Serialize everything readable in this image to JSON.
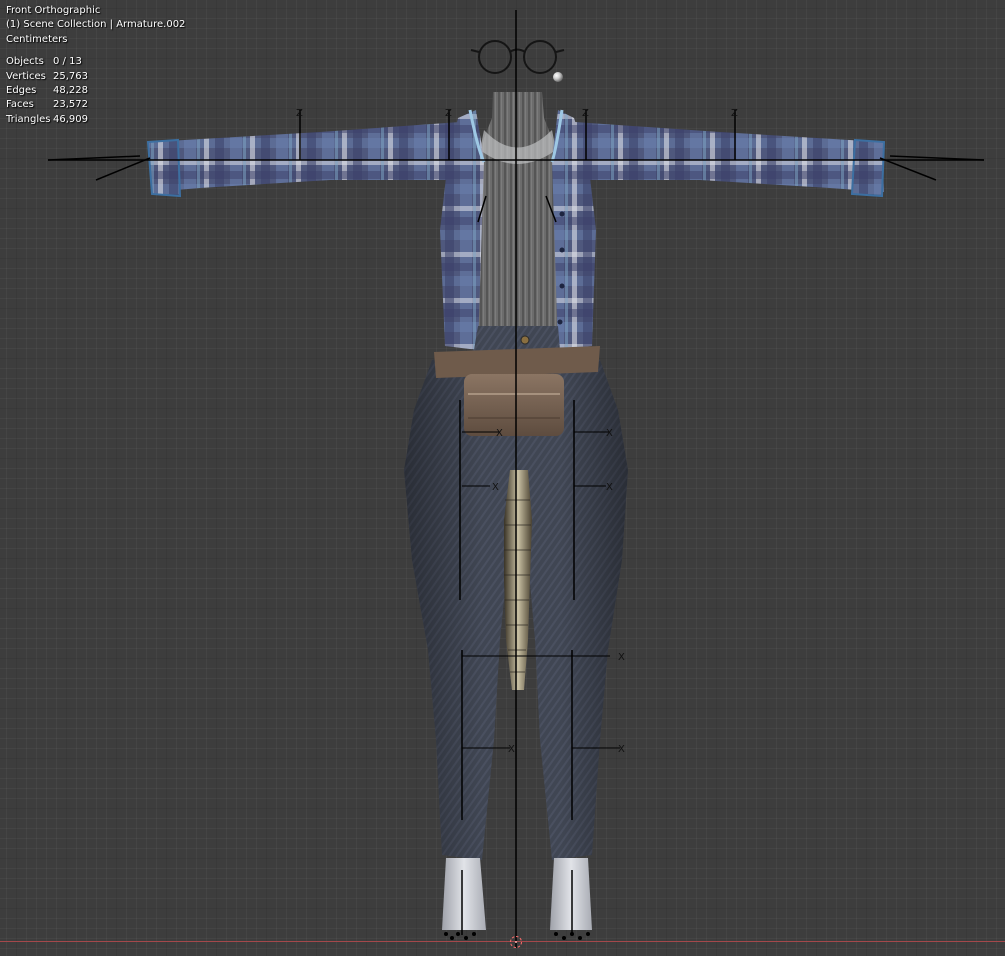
{
  "viewport": {
    "view_name": "Front Orthographic",
    "collection": "(1) Scene Collection | Armature.002",
    "units": "Centimeters",
    "stats": [
      {
        "label": "Objects",
        "value": "0 / 13"
      },
      {
        "label": "Vertices",
        "value": "25,763"
      },
      {
        "label": "Edges",
        "value": "48,228"
      },
      {
        "label": "Faces",
        "value": "23,572"
      },
      {
        "label": "Triangles",
        "value": "46,909"
      }
    ]
  },
  "colors": {
    "background": "#3d3d3d",
    "x_axis": "#a4484b",
    "jeans": "#3f4452",
    "plaid_base": "#4d567c",
    "tank_top": "#6b6b6b",
    "belt_bag": "#7a6553",
    "shoes": "#c7c9cf",
    "bones": "#000000"
  },
  "icons": {
    "origin": "object-origin-icon",
    "light_probe": "light-probe-icon"
  }
}
